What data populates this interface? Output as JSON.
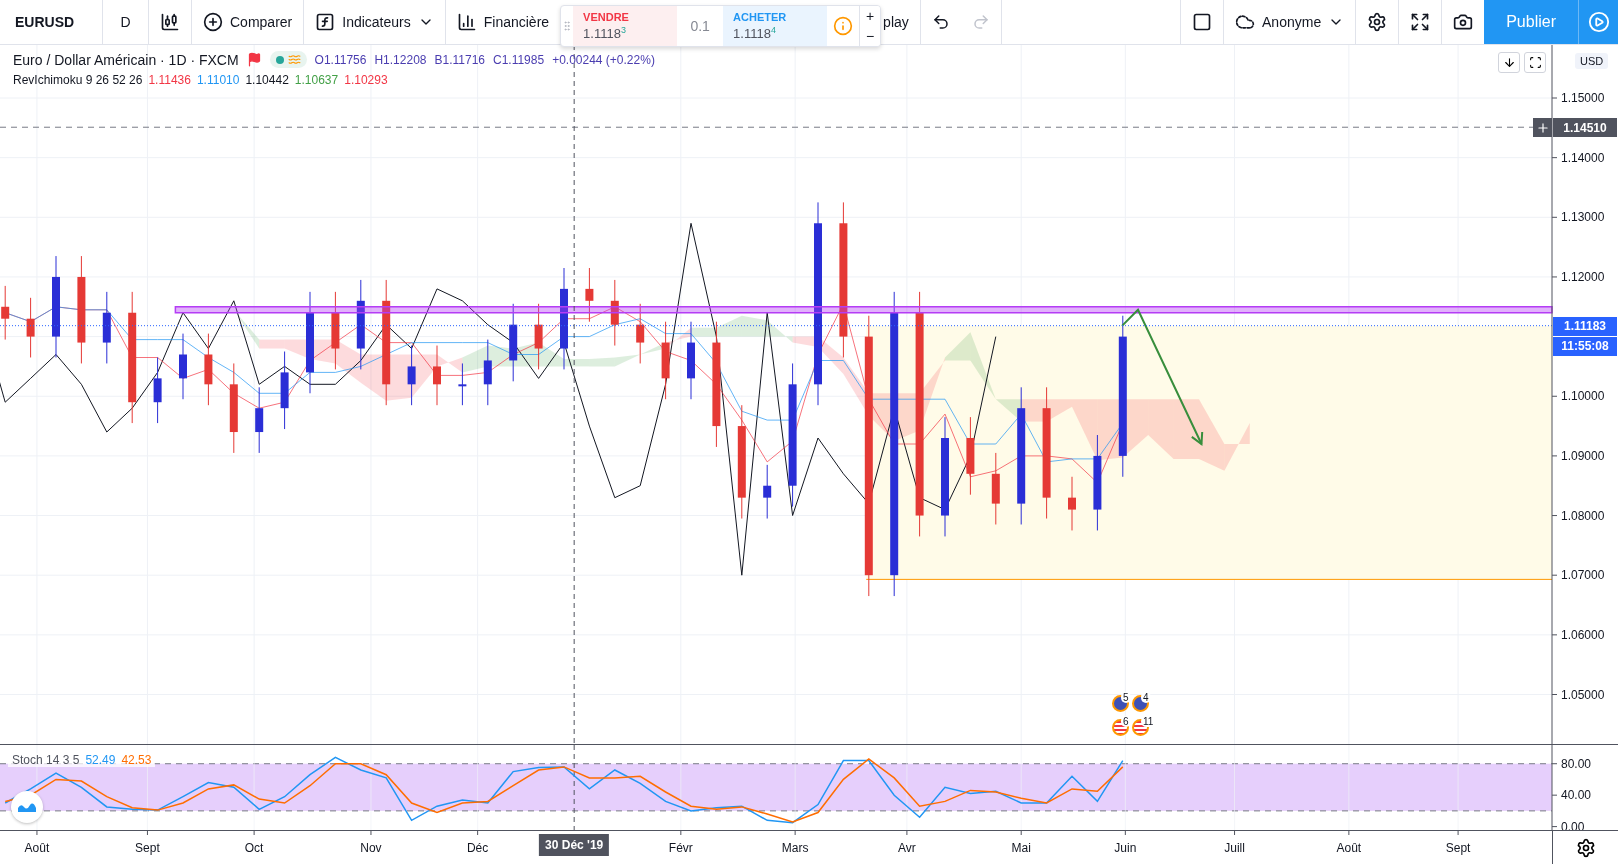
{
  "toolbar": {
    "symbol": "EURUSD",
    "interval": "D",
    "compare": "Comparer",
    "indicators": "Indicateurs",
    "financials": "Financière",
    "replay": "play",
    "redo_disabled": true,
    "account": "Anonyme",
    "publish": "Publier"
  },
  "trade_widget": {
    "sell_label": "VENDRE",
    "sell_price": "1.1118$^{3}$",
    "quantity": "0.1",
    "buy_label": "ACHETER",
    "buy_price": "1.1118$^{4}$",
    "plus": "+",
    "minus": "−"
  },
  "legend": {
    "title": "Euro / Dollar Américain · 1D · FXCM",
    "ohlc": [
      "O1.11756",
      "H1.12208",
      "B1.11716",
      "C1.11985"
    ],
    "change": "+0.00244 (+0.22%)",
    "indicator": {
      "name": "RevIchimoku 9 26 52 26",
      "values": [
        {
          "text": "1.11436",
          "color": "#f23645"
        },
        {
          "text": "1.11010",
          "color": "#2196f3"
        },
        {
          "text": "1.10442",
          "color": "#131722"
        },
        {
          "text": "1.10637",
          "color": "#43a047"
        },
        {
          "text": "1.10293",
          "color": "#f23645"
        }
      ]
    }
  },
  "price_axis": {
    "currency": "USD",
    "ticks": [
      "1.15000",
      "1.14000",
      "1.13000",
      "1.12000",
      "1.10000",
      "1.09000",
      "1.08000",
      "1.07000",
      "1.06000",
      "1.05000"
    ],
    "labels": [
      {
        "kind": "crosshair",
        "text": "1.14510"
      },
      {
        "kind": "last",
        "text": "1.11183"
      },
      {
        "kind": "countdown",
        "text": "11:55:08"
      }
    ]
  },
  "events": [
    {
      "kind": "eu",
      "label": "5"
    },
    {
      "kind": "eu",
      "label": "4"
    },
    {
      "kind": "us",
      "label": "6"
    },
    {
      "kind": "us",
      "label": "11"
    }
  ],
  "stoch_pane": {
    "title": "Stoch 14 3 5",
    "values": [
      {
        "text": "52.49",
        "color": "#2196f3"
      },
      {
        "text": "42.53",
        "color": "#ff6d00"
      }
    ],
    "ticks": [
      "80.00",
      "40.00",
      "0.00"
    ]
  },
  "time_axis": {
    "labels": [
      "Août",
      "Sept",
      "Oct",
      "Nov",
      "Déc",
      "Févr",
      "Mars",
      "Avr",
      "Mai",
      "Juin",
      "Juill",
      "Août",
      "Sept"
    ],
    "crosshair_label": "30 Déc '19"
  }
}
